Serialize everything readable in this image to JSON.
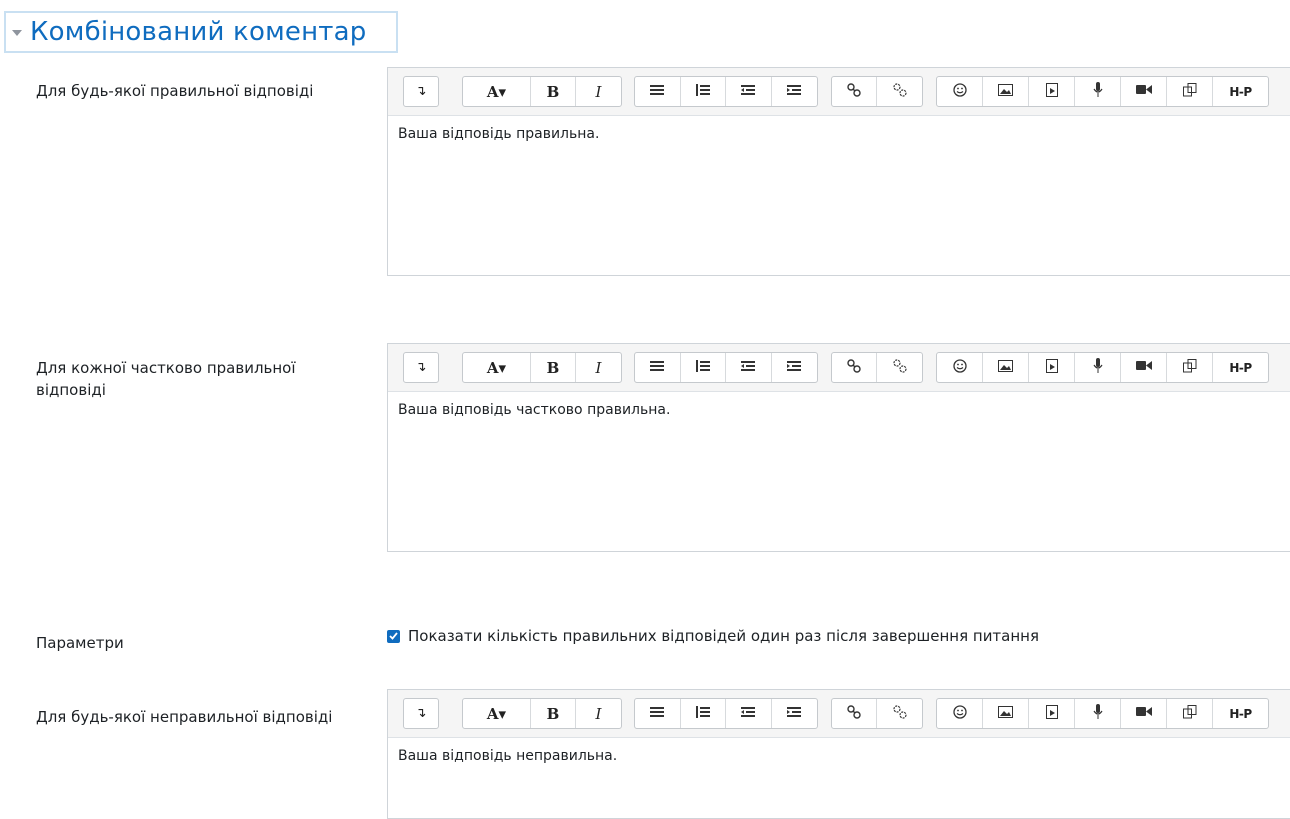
{
  "section": {
    "title": "Комбінований коментар"
  },
  "toolbar_buttons": {
    "collapse": "↴",
    "font": "A▾",
    "bold": "B",
    "italic": "I",
    "h5p": "H-P"
  },
  "editors": [
    {
      "label": "Для будь-якої правильної відповіді",
      "content": "Ваша відповідь правильна."
    },
    {
      "label": "Для кожної частково правильної відповіді",
      "content": "Ваша відповідь частково правильна."
    },
    {
      "label": "Для будь-якої неправильної відповіді",
      "content": "Ваша відповідь неправильна."
    }
  ],
  "options": {
    "label": "Параметри",
    "checkbox_label": "Показати кількість правильних відповідей один раз після завершення питання",
    "checked": true
  },
  "colors": {
    "accent": "#0f6cbf",
    "border": "#cfd4d9",
    "toolbar_bg": "#f5f5f5"
  }
}
